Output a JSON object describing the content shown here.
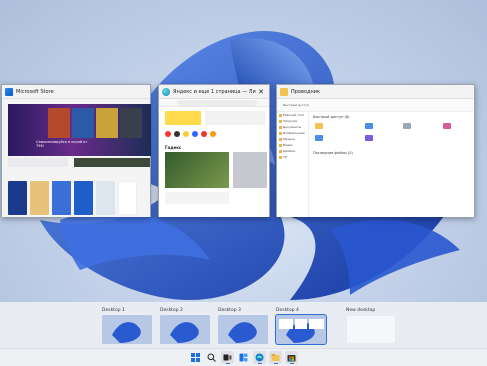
{
  "windows": {
    "store": {
      "title": "Microsoft Store",
      "hero_text": "Самоизолируйся и играй от 79$!"
    },
    "edge": {
      "title": "Яндекс и еще 1 страница — Личный Micro...",
      "section": "Гадекс"
    },
    "explorer": {
      "title": "Проводник",
      "path": "Быстрый доступ",
      "quick_access": "Быстрый доступ (8)",
      "recent": "Последние файлы (0)",
      "folders": [
        "Рабочий стол",
        "Загрузки",
        "Документы",
        "Изображения",
        "Музыка",
        "Видео",
        "Desktop",
        "YD"
      ]
    }
  },
  "desktops": [
    {
      "label": "Desktop 1"
    },
    {
      "label": "Desktop 2"
    },
    {
      "label": "Desktop 3"
    },
    {
      "label": "Desktop 4"
    },
    {
      "label": "New desktop"
    }
  ],
  "taskbar": {
    "icons": [
      "windows-start-icon",
      "search-icon",
      "task-view-icon",
      "widgets-icon",
      "edge-icon",
      "file-explorer-icon",
      "store-icon"
    ]
  },
  "colors": {
    "accent": "#2f6fd6",
    "wallpaper_blue": "#1e4fc2"
  }
}
